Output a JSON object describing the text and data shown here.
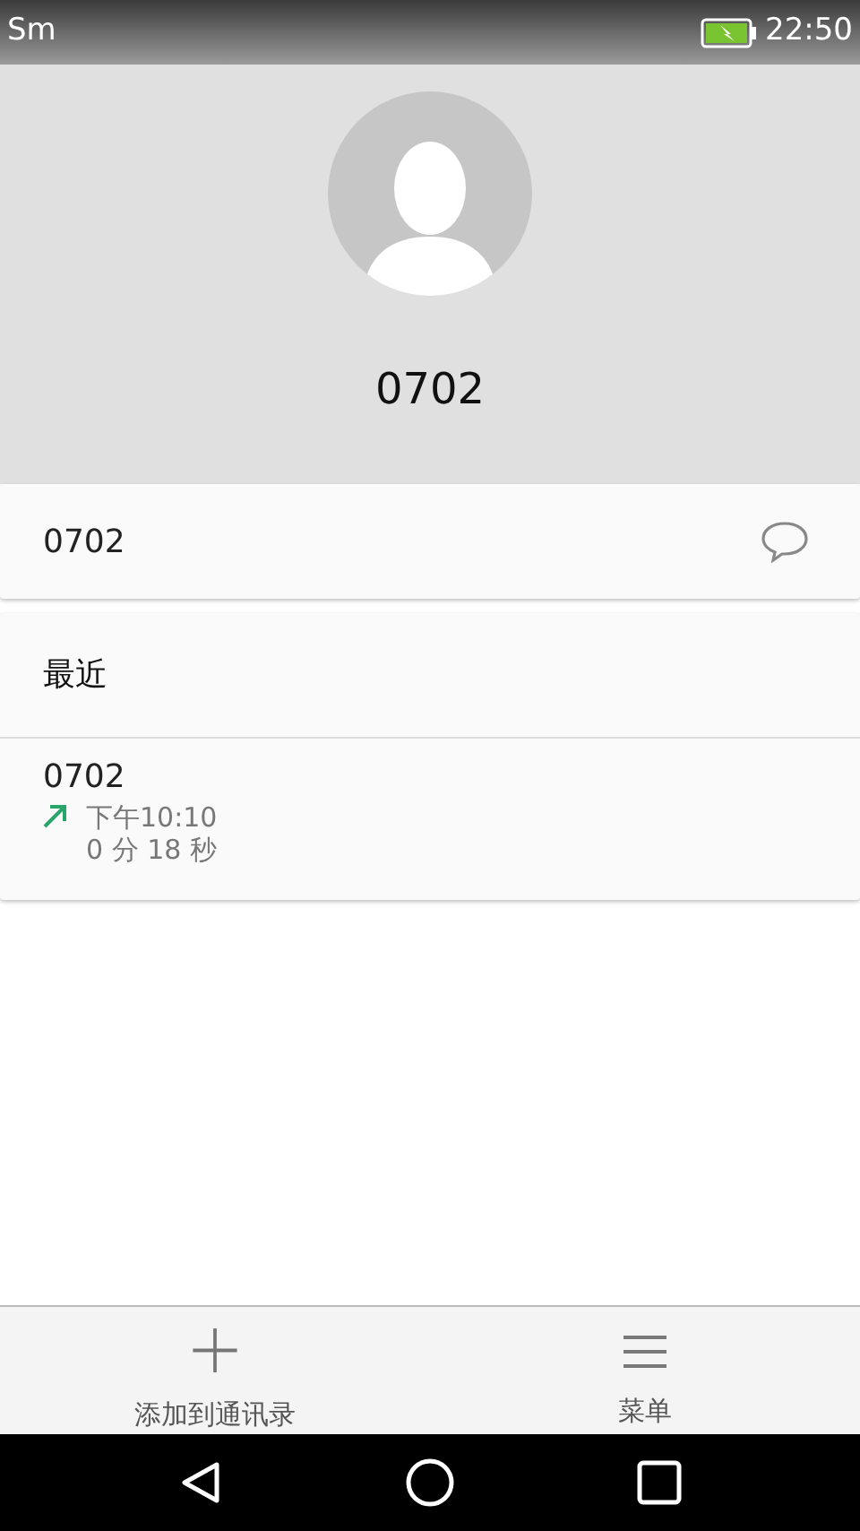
{
  "status_bar": {
    "carrier": "Sm",
    "battery": {
      "charging": true
    },
    "time": "22:50"
  },
  "contact": {
    "number": "0702"
  },
  "number_row": {
    "number": "0702"
  },
  "recent": {
    "title": "最近",
    "calls": [
      {
        "number": "0702",
        "outgoing": true,
        "time": "下午10:10",
        "duration": "0 分 18 秒"
      }
    ]
  },
  "bottom_actions": [
    {
      "kind": "add",
      "label": "添加到通讯录"
    },
    {
      "kind": "menu",
      "label": "菜单"
    }
  ]
}
